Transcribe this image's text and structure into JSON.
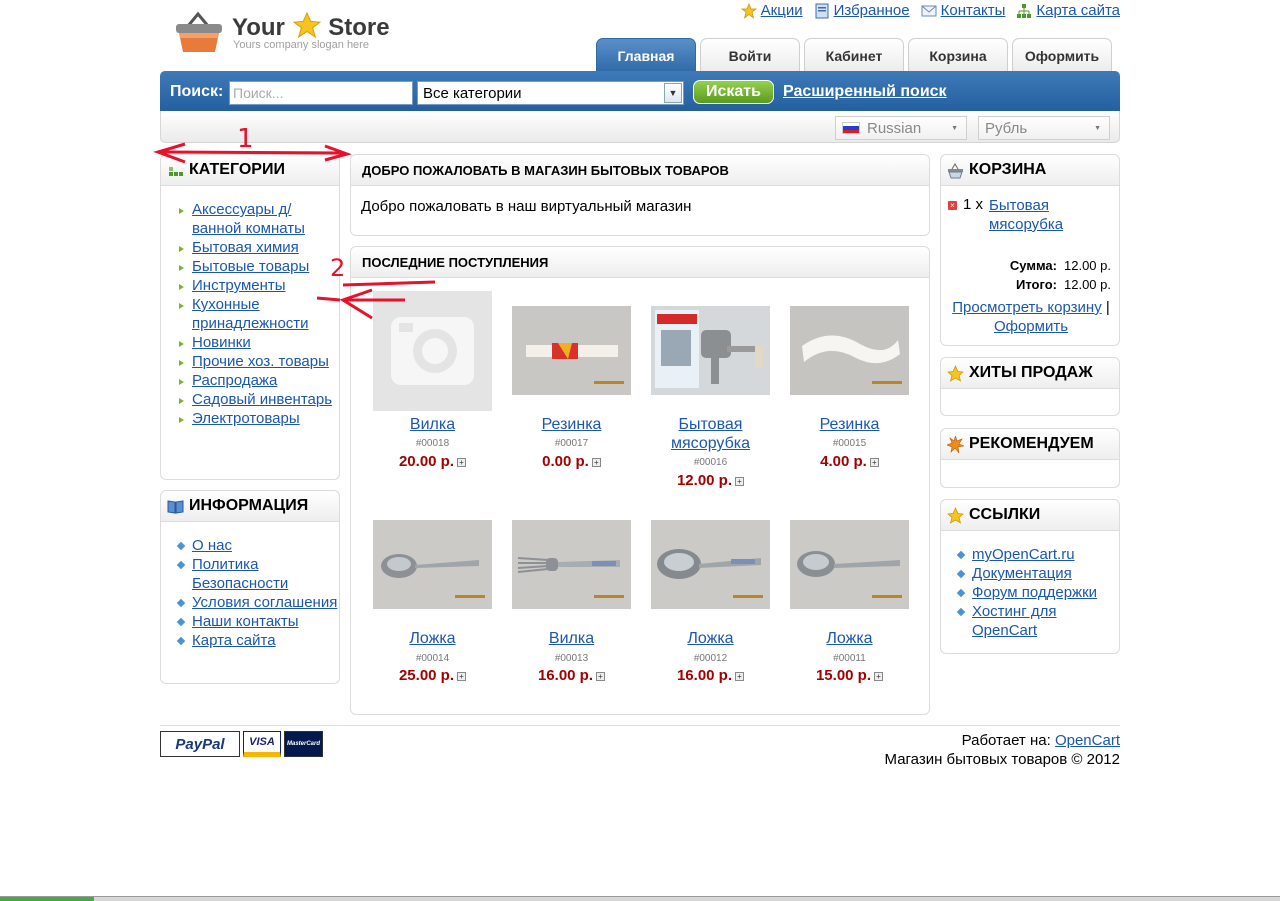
{
  "brand": {
    "name_part1": "Your",
    "name_part2": "Store",
    "slogan": "Yours company slogan here"
  },
  "top_links": [
    {
      "label": "Акции",
      "icon": "star-icon"
    },
    {
      "label": "Избранное",
      "icon": "bookmark-icon"
    },
    {
      "label": "Контакты",
      "icon": "mail-icon"
    },
    {
      "label": "Карта сайта",
      "icon": "sitemap-icon"
    }
  ],
  "tabs": [
    {
      "label": "Главная",
      "active": true
    },
    {
      "label": "Войти"
    },
    {
      "label": "Кабинет"
    },
    {
      "label": "Корзина"
    },
    {
      "label": "Оформить"
    }
  ],
  "search": {
    "label": "Поиск:",
    "placeholder": "Поиск...",
    "category": "Все категории",
    "button": "Искать",
    "advanced": "Расширенный поиск"
  },
  "language": "Russian",
  "currency": "Рубль",
  "categories": {
    "title": "КАТЕГОРИИ",
    "items": [
      "Аксессуары д/ ванной комнаты",
      "Бытовая химия",
      "Бытовые товары",
      "Инструменты",
      "Кухонные принадлежности",
      "Новинки",
      "Прочие хоз. товары",
      "Распродажа",
      "Садовый инвентарь",
      "Электротовары"
    ]
  },
  "information": {
    "title": "ИНФОРМАЦИЯ",
    "items": [
      "О нас",
      "Политика Безопасности",
      "Условия соглашения",
      "Наши контакты",
      "Карта сайта"
    ]
  },
  "welcome": {
    "title": "ДОБРО ПОЖАЛОВАТЬ В МАГАЗИН БЫТОВЫХ ТОВАРОВ",
    "text": "Добро пожаловать в наш виртуальный магазин"
  },
  "latest": {
    "title": "ПОСЛЕДНИЕ ПОСТУПЛЕНИЯ",
    "products": [
      {
        "name": "Вилка",
        "sku": "#00018",
        "price": "20.00 р."
      },
      {
        "name": "Резинка",
        "sku": "#00017",
        "price": "0.00 р."
      },
      {
        "name": "Бытовая мясорубка",
        "sku": "#00016",
        "price": "12.00 р."
      },
      {
        "name": "Резинка",
        "sku": "#00015",
        "price": "4.00 р."
      },
      {
        "name": "Ложка",
        "sku": "#00014",
        "price": "25.00 р."
      },
      {
        "name": "Вилка",
        "sku": "#00013",
        "price": "16.00 р."
      },
      {
        "name": "Ложка",
        "sku": "#00012",
        "price": "16.00 р."
      },
      {
        "name": "Ложка",
        "sku": "#00011",
        "price": "15.00 р."
      }
    ]
  },
  "cart": {
    "title": "КОРЗИНА",
    "item_qty": "1 x",
    "item_name": "Бытовая мясорубка",
    "subtotal_label": "Сумма:",
    "subtotal": "12.00 р.",
    "total_label": "Итого:",
    "total": "12.00 р.",
    "view_cart": "Просмотреть корзину",
    "separator": "|",
    "checkout": "Оформить"
  },
  "bestsellers": {
    "title": "ХИТЫ ПРОДАЖ"
  },
  "featured": {
    "title": "РЕКОМЕНДУЕМ"
  },
  "links": {
    "title": "ССЫЛКИ",
    "items": [
      "myOpenCart.ru",
      "Документация",
      "Форум поддержки",
      "Хостинг для OpenCart"
    ]
  },
  "footer": {
    "payment": [
      "PayPal",
      "VISA",
      "MasterCard"
    ],
    "powered_label": "Работает на:",
    "powered_link": "OpenCart",
    "copyright": "Магазин бытовых товаров © 2012"
  },
  "annotations": [
    "1",
    "2"
  ],
  "colors": {
    "accent_blue": "#2f6aa8",
    "price_red": "#a30000",
    "link_blue": "#1b57b1",
    "button_green": "#5a9a1e",
    "annotation_red": "#e8102a"
  }
}
